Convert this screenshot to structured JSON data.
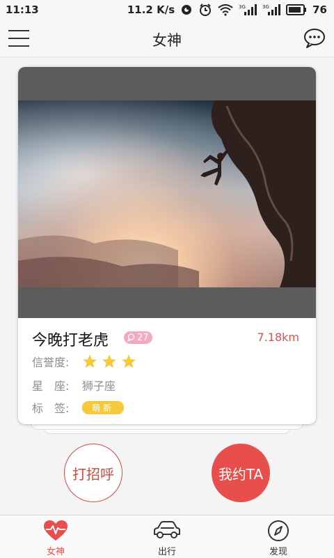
{
  "status_bar": {
    "time": "11:13",
    "net_speed": "11.2 K/s",
    "battery_level": "76",
    "icons": [
      "alarm-icon",
      "clock-icon",
      "wifi-icon",
      "signal-3g-icon",
      "signal-3g-icon",
      "battery-icon"
    ]
  },
  "header": {
    "title": "女神",
    "left_icon": "menu-icon",
    "right_icon": "chat-bubble-icon"
  },
  "profile": {
    "nickname": "今晚打老虎",
    "message_count": "27",
    "distance": "7.18km",
    "credit_label": "信誉度:",
    "credit_stars": 3,
    "zodiac_label": "星　座:",
    "zodiac_value": "狮子座",
    "tag_label": "标　签:",
    "tags": [
      "萌新"
    ]
  },
  "actions": {
    "greet_label": "打招呼",
    "date_label": "我约TA"
  },
  "tabs": [
    {
      "label": "女神",
      "icon": "heart-pulse-icon",
      "active": true
    },
    {
      "label": "出行",
      "icon": "car-icon",
      "active": false
    },
    {
      "label": "发现",
      "icon": "compass-icon",
      "active": false
    }
  ],
  "colors": {
    "accent": "#e84f4c",
    "star": "#f6c93d",
    "badge": "#f3a9c1",
    "distance": "#d9534f"
  }
}
